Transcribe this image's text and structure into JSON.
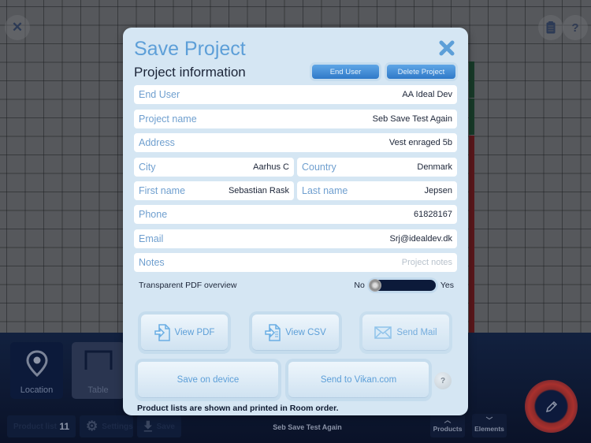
{
  "canvas": {
    "close_icon": "close-icon",
    "clipboard_icon": "clipboard-icon",
    "help_label": "?"
  },
  "modal": {
    "title": "Save Project",
    "section_title": "Project information",
    "end_user_button": "End User",
    "delete_project_button": "Delete Project",
    "fields": {
      "end_user": {
        "label": "End User",
        "value": "AA Ideal Dev"
      },
      "project_name": {
        "label": "Project name",
        "value": "Seb Save Test Again"
      },
      "address": {
        "label": "Address",
        "value": "Vest enraged 5b"
      },
      "city": {
        "label": "City",
        "value": "Aarhus C"
      },
      "country": {
        "label": "Country",
        "value": "Denmark"
      },
      "first_name": {
        "label": "First name",
        "value": "Sebastian Rask"
      },
      "last_name": {
        "label": "Last name",
        "value": "Jepsen"
      },
      "phone": {
        "label": "Phone",
        "value": "61828167"
      },
      "email": {
        "label": "Email",
        "value": "Srj@idealdev.dk"
      },
      "notes": {
        "label": "Notes",
        "placeholder": "Project notes"
      }
    },
    "transparent_pdf": {
      "label": "Transparent PDF overview",
      "off_label": "No",
      "on_label": "Yes",
      "state": "off"
    },
    "buttons": {
      "view_pdf": "View PDF",
      "view_csv": "View CSV",
      "send_mail": "Send Mail",
      "save_on_device": "Save on device",
      "send_to_vikan": "Send to Vikan.com",
      "help": "?"
    },
    "footnote": "Product lists are shown and printed in Room order.",
    "accent_color": "#5d9fd8"
  },
  "bottom": {
    "tiles": [
      {
        "label": "Location"
      },
      {
        "label": "Table"
      }
    ],
    "product_list": {
      "label": "Product list",
      "count": "11"
    },
    "settings_label": "Settings",
    "save_label": "Save",
    "project_title": "Seb Save Test Again",
    "products_label": "Products",
    "elements_label": "Elements"
  }
}
